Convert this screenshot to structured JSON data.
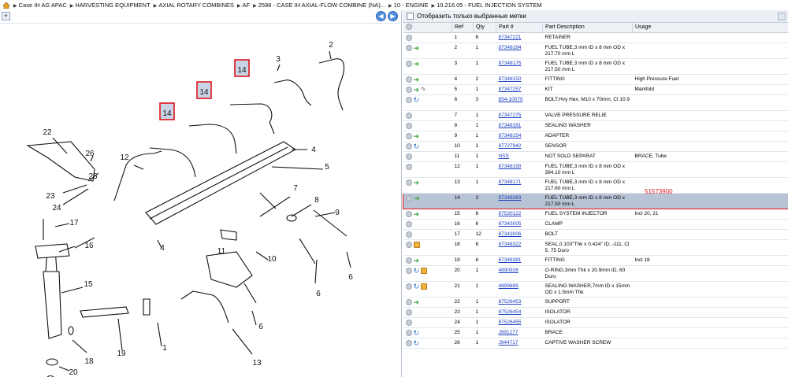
{
  "breadcrumb": [
    "Case IH AG APAC",
    "HARVESTING EQUIPMENT",
    "AXIAL ROTARY COMBINES",
    "AF",
    "2588 - CASE IH AXIAL-FLOW COMBINE (NA)...",
    "10 - ENGINE",
    "10.216.05 - FUEL INJECTION SYSTEM"
  ],
  "toolbar": {
    "expand": "+",
    "prev": "◀",
    "next": "▶"
  },
  "filter_label": "Отобразить только выбранные метки",
  "columns": [
    "Ref",
    "Qty",
    "Part #",
    "Part Description",
    "Usage"
  ],
  "highlight_overlay": "51573900",
  "diagram_labels": [
    "2",
    "3",
    "14",
    "14",
    "14",
    "22",
    "26",
    "25",
    "23",
    "24",
    "12",
    "4",
    "5",
    "7",
    "8",
    "9",
    "6",
    "17",
    "16",
    "15",
    "11",
    "10",
    "4",
    "6",
    "6",
    "20",
    "21",
    "18",
    "19",
    "1",
    "13"
  ],
  "rows": [
    {
      "icons": [
        "circle"
      ],
      "ref": "1",
      "qty": "6",
      "part": "87347221",
      "desc": "RETAINER",
      "usage": ""
    },
    {
      "icons": [
        "circle",
        "green"
      ],
      "ref": "2",
      "qty": "1",
      "part": "87348184",
      "desc": "FUEL TUBE,3 mm ID x 8 mm OD x 217.70 mm L",
      "usage": ""
    },
    {
      "icons": [
        "circle",
        "green"
      ],
      "ref": "3",
      "qty": "1",
      "part": "87348175",
      "desc": "FUEL TUBE,3 mm ID x 8 mm OD x 217.50 mm L",
      "usage": ""
    },
    {
      "icons": [
        "circle",
        "green"
      ],
      "ref": "4",
      "qty": "2",
      "part": "87348150",
      "desc": "FITTING",
      "usage": "High Pressure Fuel"
    },
    {
      "icons": [
        "circle",
        "green",
        "wrench"
      ],
      "ref": "5",
      "qty": "1",
      "part": "87347257",
      "desc": "KIT",
      "usage": "Manifold"
    },
    {
      "icons": [
        "circle",
        "blue"
      ],
      "ref": "6",
      "qty": "3",
      "part": "854-10070",
      "desc": "BOLT,Hvy Hex, M10 x 70mm, Cl 10.9",
      "usage": ""
    },
    {
      "icons": [
        "circle"
      ],
      "ref": "7",
      "qty": "1",
      "part": "87347275",
      "desc": "VALVE PRESSURE RELIE",
      "usage": ""
    },
    {
      "icons": [
        "circle"
      ],
      "ref": "8",
      "qty": "1",
      "part": "87348161",
      "desc": "SEALING WASHER",
      "usage": ""
    },
    {
      "icons": [
        "circle",
        "green"
      ],
      "ref": "9",
      "qty": "1",
      "part": "87348154",
      "desc": "ADAPTER",
      "usage": ""
    },
    {
      "icons": [
        "circle",
        "blue"
      ],
      "ref": "10",
      "qty": "1",
      "part": "87727942",
      "desc": "SENSOR",
      "usage": ""
    },
    {
      "icons": [
        "circle"
      ],
      "ref": "11",
      "qty": "1",
      "part": "NSS",
      "desc": "NOT SOLD SEPARAT",
      "usage": "BRACE, Tube"
    },
    {
      "icons": [
        "circle"
      ],
      "ref": "12",
      "qty": "1",
      "part": "87348190",
      "desc": "FUEL TUBE,3 mm ID x 8 mm OD x 394.10 mm L",
      "usage": ""
    },
    {
      "icons": [
        "circle",
        "green"
      ],
      "ref": "13",
      "qty": "1",
      "part": "87348171",
      "desc": "FUEL TUBE,3 mm ID x 8 mm OD x 217.60 mm L",
      "usage": ""
    },
    {
      "icons": [
        "circle",
        "green"
      ],
      "ref": "14",
      "qty": "3",
      "part": "87348283",
      "desc": "FUEL TUBE,3 mm ID x 8 mm OD x 217.50 mm L",
      "usage": "",
      "selected": true
    },
    {
      "icons": [
        "circle",
        "green"
      ],
      "ref": "15",
      "qty": "6",
      "part": "87530122",
      "desc": "FUEL SYSTEM INJECTOR",
      "usage": "Incl 20, 21"
    },
    {
      "icons": [
        "circle"
      ],
      "ref": "16",
      "qty": "6",
      "part": "87343005",
      "desc": "CLAMP",
      "usage": ""
    },
    {
      "icons": [
        "circle"
      ],
      "ref": "17",
      "qty": "12",
      "part": "87343006",
      "desc": "BOLT",
      "usage": ""
    },
    {
      "icons": [
        "circle",
        "orange"
      ],
      "ref": "18",
      "qty": "6",
      "part": "87348322",
      "desc": "SEAL,0.103\"Thk x 0.424\" ID, -111, Cl 5, 75 Duro",
      "usage": ""
    },
    {
      "icons": [
        "circle",
        "green"
      ],
      "ref": "19",
      "qty": "6",
      "part": "87348381",
      "desc": "FITTING",
      "usage": "Incl 18"
    },
    {
      "icons": [
        "circle",
        "blue",
        "orange"
      ],
      "ref": "20",
      "qty": "1",
      "part": "4890926",
      "desc": "O-RING,3mm Thk x 20.9mm ID, 60 Duro",
      "usage": ""
    },
    {
      "icons": [
        "circle",
        "blue",
        "orange"
      ],
      "ref": "21",
      "qty": "1",
      "part": "4899889",
      "desc": "SEALING WASHER,7mm ID x 15mm OD x 1.5mm Thk",
      "usage": ""
    },
    {
      "icons": [
        "circle",
        "green"
      ],
      "ref": "22",
      "qty": "1",
      "part": "87526453",
      "desc": "SUPPORT",
      "usage": ""
    },
    {
      "icons": [
        "circle"
      ],
      "ref": "23",
      "qty": "1",
      "part": "87526454",
      "desc": "ISOLATOR",
      "usage": ""
    },
    {
      "icons": [
        "circle"
      ],
      "ref": "24",
      "qty": "1",
      "part": "87526455",
      "desc": "ISOLATOR",
      "usage": ""
    },
    {
      "icons": [
        "circle",
        "blue"
      ],
      "ref": "25",
      "qty": "1",
      "part": "J991277",
      "desc": "BRACE",
      "usage": ""
    },
    {
      "icons": [
        "circle",
        "blue"
      ],
      "ref": "26",
      "qty": "1",
      "part": "J944717",
      "desc": "CAPTIVE WASHER SCREW",
      "usage": ""
    }
  ]
}
